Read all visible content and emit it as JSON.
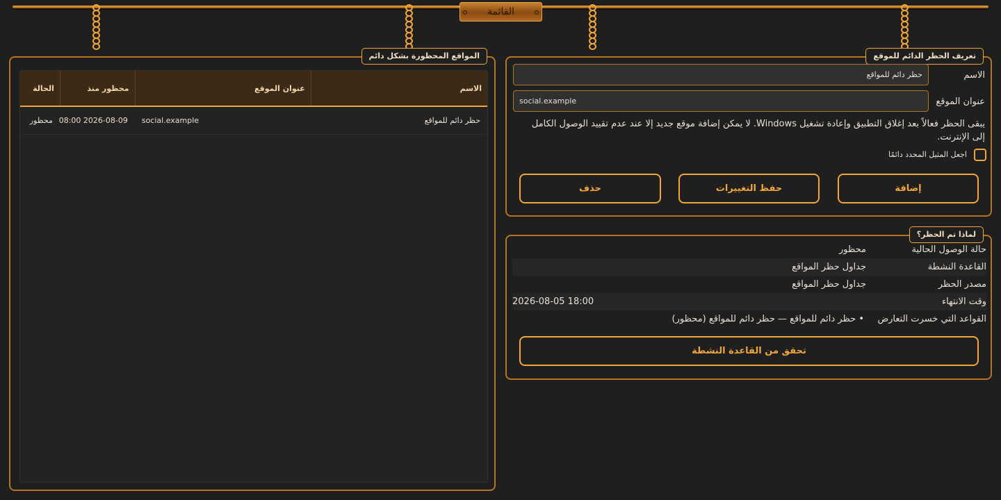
{
  "menu": {
    "label": "القائمة"
  },
  "blocked_list": {
    "title": "المواقع المحظورة بشكل دائم",
    "columns": {
      "name": "الاسم",
      "url": "عنوان الموقع",
      "since": "محظور منذ",
      "status": "الحالة"
    },
    "rows": [
      {
        "name": "حظر دائم للمواقع",
        "url": "social.example",
        "since": "2026-08-09 08:00",
        "status": "محظور"
      }
    ]
  },
  "definition": {
    "title": "تعريف الحظر الدائم للموقع",
    "name_label": "الاسم",
    "name_value": "حظر دائم للمواقع",
    "url_label": "عنوان الموقع",
    "url_value": "social.example",
    "note": "يبقى الحظر فعالاً بعد إغلاق التطبيق وإعادة تشغيل Windows. لا يمكن إضافة موقع جديد إلا عند عدم تقييد الوصول الكامل إلى الإنترنت.",
    "checkbox_label": "اجعل المثيل المحدد دائمًا",
    "add_button": "إضافة",
    "save_button": "حفظ التغييرات",
    "delete_button": "حذف"
  },
  "why": {
    "title": "لماذا تم الحظر؟",
    "access_state_label": "حالة الوصول الحالية",
    "access_state_value": "محظور",
    "active_rule_label": "القاعدة النشطة",
    "active_rule_value": "جداول حظر المواقع",
    "block_source_label": "مصدر الحظر",
    "block_source_value": "جداول حظر المواقع",
    "end_time_label": "وقت الانتهاء",
    "end_time_value": "2026-08-05 18:00",
    "lost_rules_label": "القواعد التي خسرت التعارض",
    "lost_rules_value": "• حظر دائم للمواقع — حظر دائم للمواقع (محظور)",
    "check_button": "تحقق من القاعدة النشطة"
  },
  "colors": {
    "accent": "#f0a63d",
    "background": "#1f1f1f",
    "header": "#3b2a17"
  }
}
